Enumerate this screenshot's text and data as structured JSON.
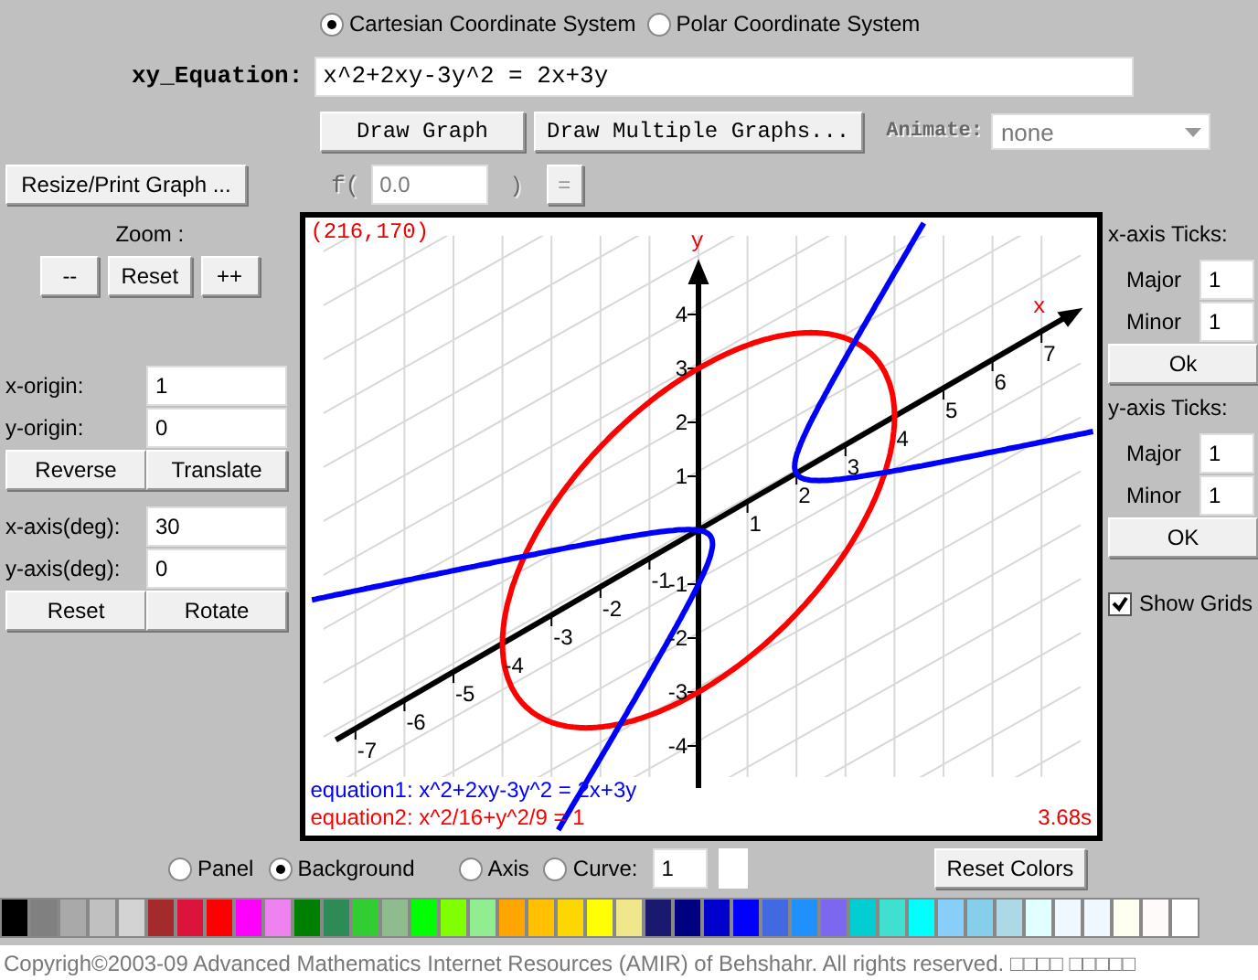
{
  "coordinate_systems": [
    {
      "label": "Cartesian Coordinate System",
      "selected": true
    },
    {
      "label": "Polar Coordinate System",
      "selected": false
    }
  ],
  "equation": {
    "label": "xy_Equation:",
    "value": "x^2+2xy-3y^2 = 2x+3y"
  },
  "actions": {
    "draw": "Draw Graph",
    "draw_multiple": "Draw Multiple Graphs...",
    "animate_label": "Animate:",
    "animate_value": "none",
    "animate_disabled": true
  },
  "evaluate": {
    "resize": "Resize/Print Graph ...",
    "open": "f(",
    "value": "0.0",
    "close": ")",
    "equals": "=",
    "disabled": true
  },
  "zoom": {
    "label": "Zoom :",
    "buttons": [
      "--",
      "Reset",
      "++"
    ]
  },
  "origin": {
    "fields": [
      {
        "label": "x-origin:",
        "value": "1"
      },
      {
        "label": "y-origin:",
        "value": "0"
      }
    ],
    "buttons": [
      "Reverse",
      "Translate"
    ]
  },
  "axes": {
    "fields": [
      {
        "label": "x-axis(deg):",
        "value": "30"
      },
      {
        "label": "y-axis(deg):",
        "value": "0"
      }
    ],
    "buttons": [
      "Reset",
      "Rotate"
    ]
  },
  "graph": {
    "cursor": "(216,170)",
    "x_label": "x",
    "y_label": "y",
    "x_ticks": [
      "-7",
      "-6",
      "-5",
      "-4",
      "-3",
      "-2",
      "-1",
      "1",
      "2",
      "3",
      "4",
      "5",
      "6",
      "7"
    ],
    "y_ticks": [
      "4",
      "3",
      "2",
      "1",
      "-1",
      "-2",
      "-3",
      "-4"
    ],
    "equations": [
      {
        "text": "equation1: x^2+2xy-3y^2 = 2x+3y",
        "color": "#0000ff"
      },
      {
        "text": "equation2: x^2/16+y^2/9 = 1",
        "color": "#ff0000"
      }
    ],
    "time": "3.68s"
  },
  "x_ticks_panel": {
    "title": "x-axis Ticks:",
    "major_label": "Major",
    "major": "1",
    "minor_label": "Minor",
    "minor": "1",
    "button": "Ok"
  },
  "y_ticks_panel": {
    "title": "y-axis Ticks:",
    "major_label": "Major",
    "major": "1",
    "minor_label": "Minor",
    "minor": "1",
    "button": "OK"
  },
  "show_grids": {
    "label": "Show Grids",
    "checked": true
  },
  "color_targets": [
    {
      "label": "Panel",
      "selected": false
    },
    {
      "label": "Background",
      "selected": true
    },
    {
      "label": "Axis",
      "selected": false
    },
    {
      "label": "Curve:",
      "selected": false
    }
  ],
  "curve_number": "1",
  "reset_colors": "Reset Colors",
  "swatches": [
    {
      "color": "#000000"
    },
    {
      "color": "#808080"
    },
    {
      "color": "#a9a9a9"
    },
    {
      "color": "#c0c0c0"
    },
    {
      "color": "#d3d3d3"
    },
    {
      "color": "#a52a2a"
    },
    {
      "color": "#dc143c"
    },
    {
      "color": "#ff0000"
    },
    {
      "color": "#ff00ff"
    },
    {
      "color": "#ee82ee"
    },
    {
      "color": "#008000"
    },
    {
      "color": "#2e8b57"
    },
    {
      "color": "#32cd32"
    },
    {
      "color": "#8fbc8f"
    },
    {
      "color": "#00ff00"
    },
    {
      "color": "#7fff00"
    },
    {
      "color": "#90ee90"
    },
    {
      "color": "#ffa500"
    },
    {
      "color": "#ffc000"
    },
    {
      "color": "#ffd700"
    },
    {
      "color": "#ffff00"
    },
    {
      "color": "#f0e68c"
    },
    {
      "color": "#191970"
    },
    {
      "color": "#000080"
    },
    {
      "color": "#0000cd"
    },
    {
      "color": "#0000ff"
    },
    {
      "color": "#4169e1"
    },
    {
      "color": "#1e90ff"
    },
    {
      "color": "#7b68ee"
    },
    {
      "color": "#00ced1"
    },
    {
      "color": "#40e0d0"
    },
    {
      "color": "#00ffff"
    },
    {
      "color": "#87cefa"
    },
    {
      "color": "#87ceeb"
    },
    {
      "color": "#add8e6"
    },
    {
      "color": "#e0ffff"
    },
    {
      "color": "#f0f8ff"
    },
    {
      "color": "#f0f8ff"
    },
    {
      "color": "#fffff0"
    },
    {
      "color": "#fffafa"
    },
    {
      "color": "#ffffff"
    }
  ],
  "footer": "Copyrigh©2003-09  Advanced Mathematics Internet Resources (AMIR) of Behshahr.  All rights reserved.  □□□□ □□□□□"
}
